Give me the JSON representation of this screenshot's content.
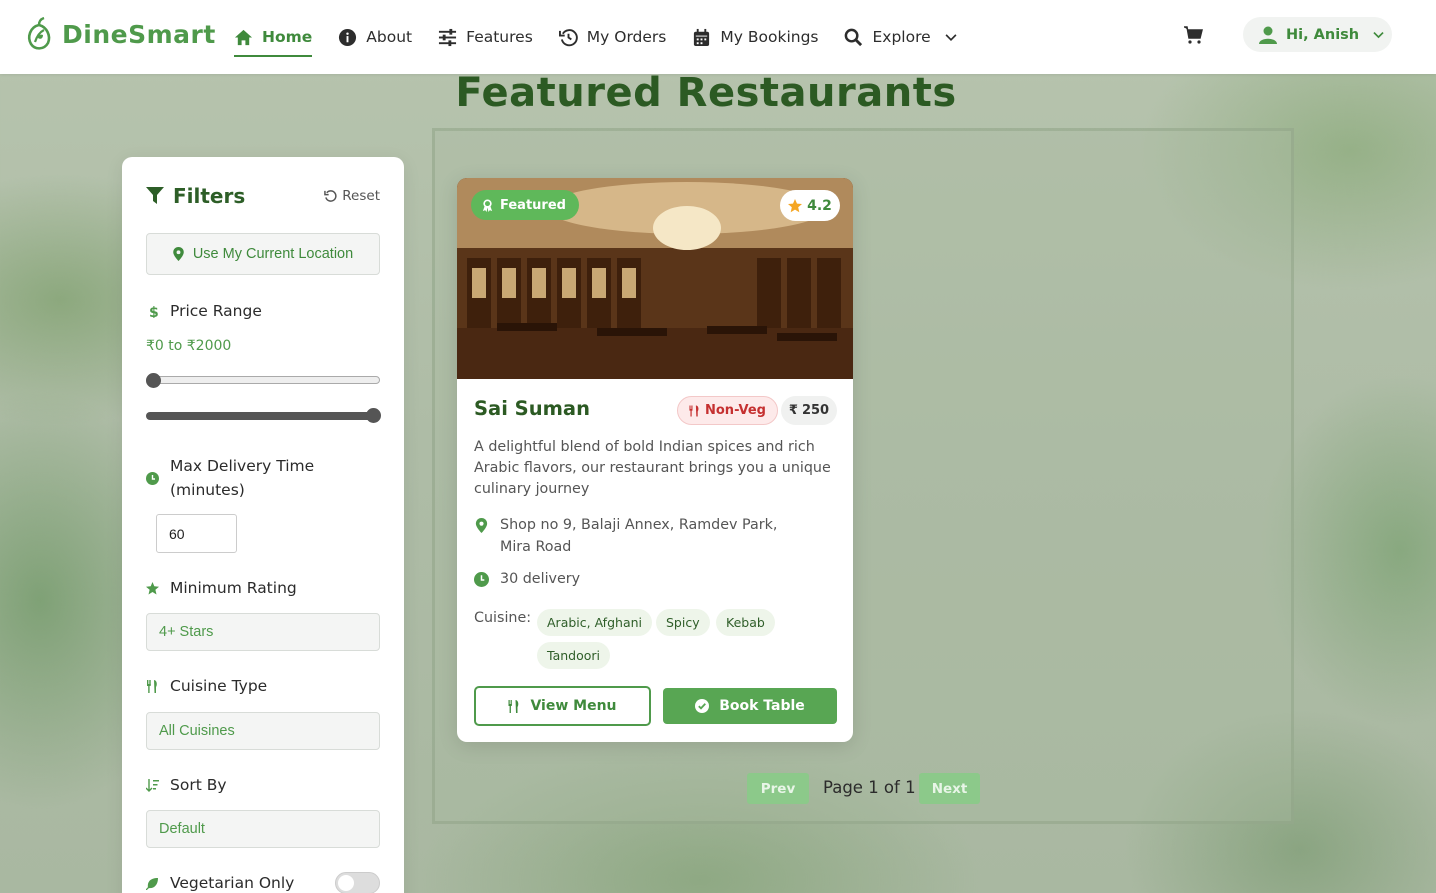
{
  "nav": {
    "brand": "DineSmart",
    "links": [
      {
        "label": "Home",
        "icon": "home-icon",
        "active": true
      },
      {
        "label": "About",
        "icon": "info-icon"
      },
      {
        "label": "Features",
        "icon": "sliders-icon"
      },
      {
        "label": "My Orders",
        "icon": "history-icon"
      },
      {
        "label": "My Bookings",
        "icon": "calendar-icon"
      },
      {
        "label": "Explore",
        "icon": "search-icon"
      }
    ],
    "user_greeting": "Hi, Anish"
  },
  "page_title": "Featured Restaurants",
  "filters": {
    "title": "Filters",
    "reset": "Reset",
    "location_button": "Use My Current Location",
    "price_label": "Price Range",
    "price_range": "₹0 to ₹2000",
    "price_min_fraction": 0,
    "price_max_fraction": 1,
    "delivery_label": "Max Delivery Time (minutes)",
    "delivery_value": "60",
    "rating_label": "Minimum Rating",
    "rating_value": "4+ Stars",
    "cuisine_label": "Cuisine Type",
    "cuisine_value": "All Cuisines",
    "sort_label": "Sort By",
    "sort_value": "Default",
    "veg_label": "Vegetarian Only",
    "veg_only": false
  },
  "restaurant": {
    "featured_badge": "Featured",
    "rating": "4.2",
    "name": "Sai Suman",
    "diet": "Non-Veg",
    "price": "250",
    "currency": "₹",
    "description": "A delightful blend of bold Indian spices and rich Arabic flavors, our restaurant brings you a unique culinary journey",
    "address": "Shop no 9, Balaji Annex, Ramdev Park, Mira Road",
    "delivery": "30 delivery",
    "cuisine_label": "Cuisine:",
    "cuisines": [
      "Arabic, Afghani",
      "Spicy",
      "Kebab",
      "Tandoori"
    ],
    "view_menu": "View Menu",
    "book_table": "Book Table"
  },
  "pagination": {
    "prev": "Prev",
    "page_text": "Page 1 of 1",
    "next": "Next"
  },
  "colors": {
    "brand_green": "#4f9a4b",
    "dark_green": "#2c5a23",
    "nonveg_red": "#c53030"
  }
}
